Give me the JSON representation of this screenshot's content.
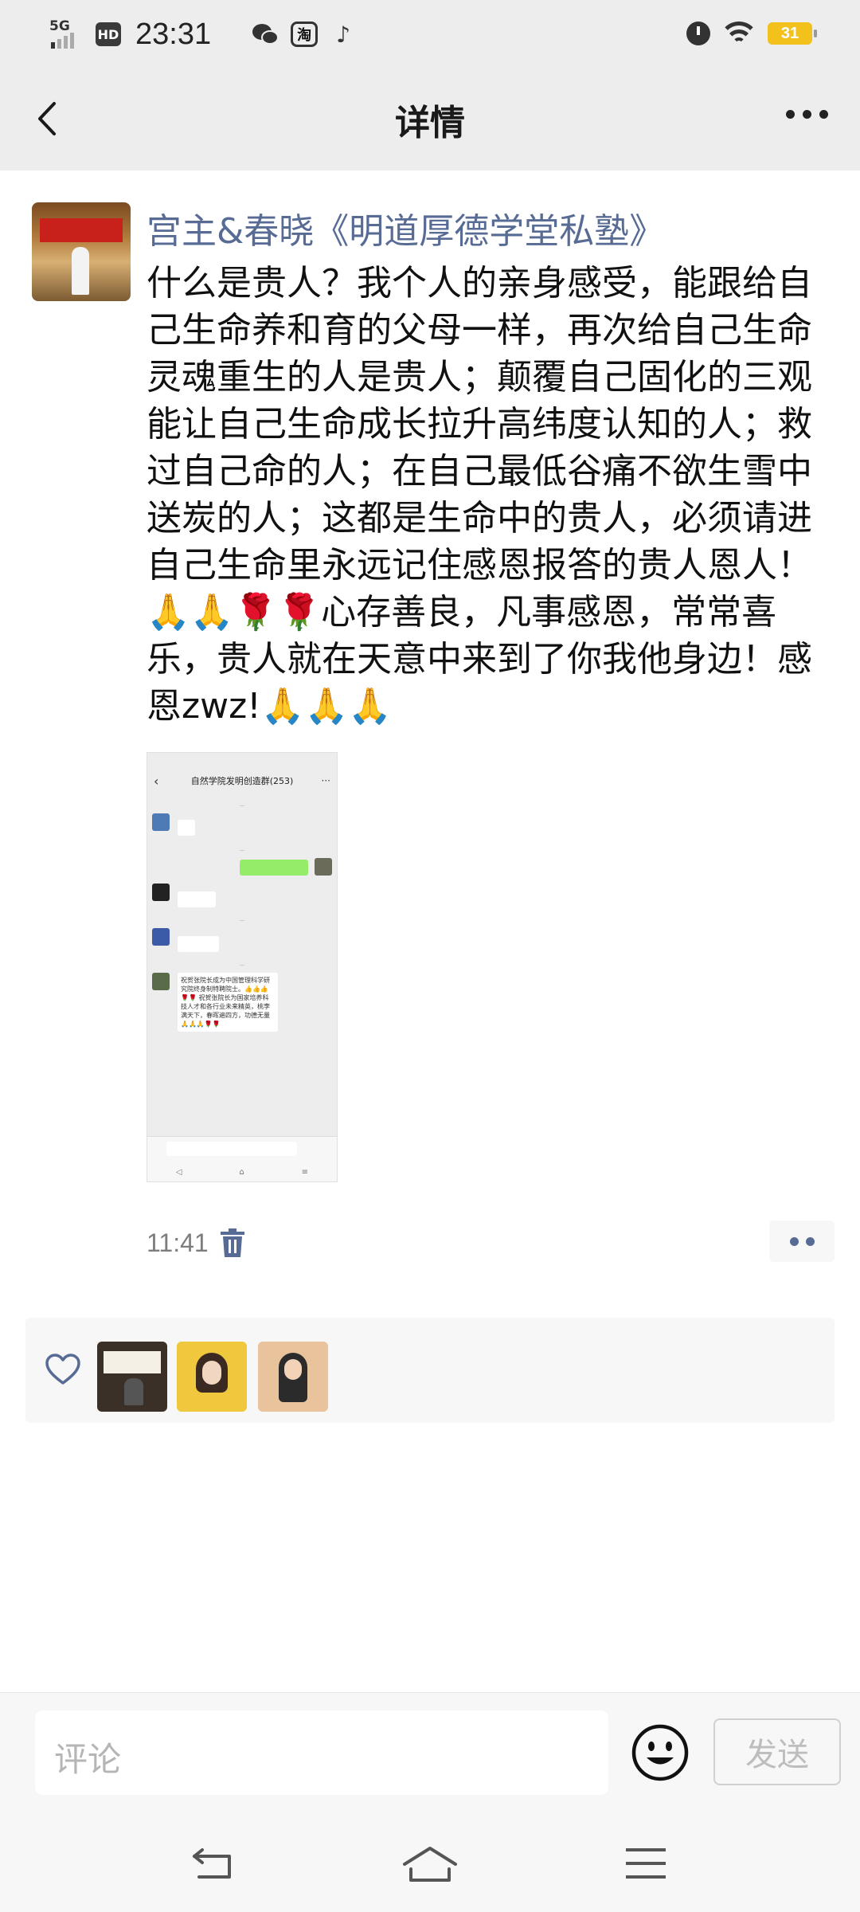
{
  "status_bar": {
    "network": "5G",
    "hd": "HD",
    "time": "23:31",
    "app_icons": [
      "wechat-icon",
      "taobao-icon",
      "tiktok-icon"
    ],
    "taobao_label": "淘",
    "battery": "31"
  },
  "nav": {
    "title": "详情"
  },
  "post": {
    "author": "宫主&春晓《明道厚德学堂私塾》",
    "content": "什么是贵人？我个人的亲身感受，能跟给自己生命养和育的父母一样，再次给自己生命灵魂重生的人是贵人；颠覆自己固化的三观能让自己生命成长拉升高纬度认知的人；救过自己命的人；在自己最低谷痛不欲生雪中送炭的人；这都是生命中的贵人，必须请进自己生命里永远记住感恩报答的贵人恩人！ 🙏🙏🌹🌹心存善良，凡事感恩，常常喜乐，贵人就在天意中来到了你我他身边！感恩zwz!🙏🙏🙏",
    "time": "11:41",
    "attachment": {
      "chat_title": "自然学院发明创造群(253)",
      "message": "祝贺张院长成为中国管理科学研究院终身制特聘院士。👍👍👍🌹🌹 祝贺张院长为国家培养科技人才和各行业未来精英，桃李满天下，春晖遍四方，功德无量🙏🙏🙏🌹🌹"
    }
  },
  "likes": {
    "count": 3
  },
  "comment_bar": {
    "placeholder": "评论",
    "send_label": "发送"
  },
  "colors": {
    "link": "#576b95",
    "background_bar": "#ededed",
    "panel": "#f7f7f7"
  }
}
